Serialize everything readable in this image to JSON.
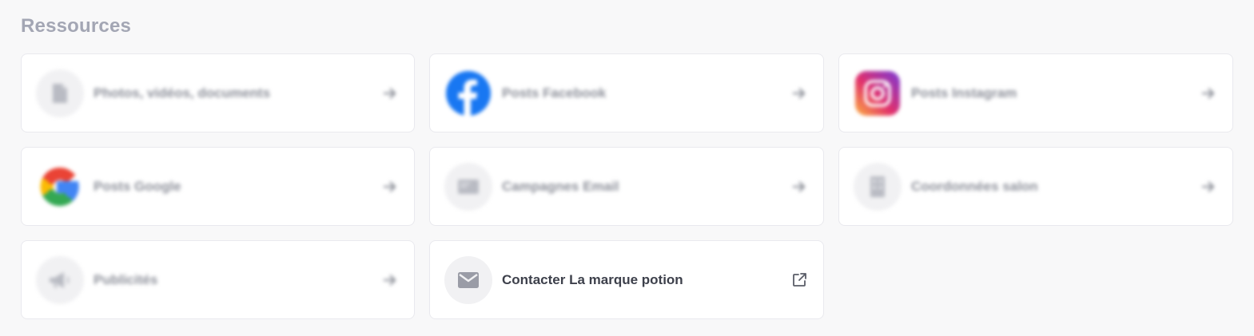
{
  "section": {
    "title": "Ressources"
  },
  "cards": [
    {
      "label": "Photos, vidéos, documents",
      "icon": "document-icon",
      "action": "arrow-right-icon"
    },
    {
      "label": "Posts Facebook",
      "icon": "facebook-icon",
      "action": "arrow-right-icon"
    },
    {
      "label": "Posts Instagram",
      "icon": "instagram-icon",
      "action": "arrow-right-icon"
    },
    {
      "label": "Posts Google",
      "icon": "google-icon",
      "action": "arrow-right-icon"
    },
    {
      "label": "Campagnes Email",
      "icon": "email-campaign-icon",
      "action": "arrow-right-icon"
    },
    {
      "label": "Coordonnées salon",
      "icon": "building-icon",
      "action": "arrow-right-icon"
    },
    {
      "label": "Publicités",
      "icon": "megaphone-icon",
      "action": "arrow-right-icon"
    },
    {
      "label": "Contacter La marque potion",
      "icon": "envelope-icon",
      "action": "external-link-icon"
    }
  ],
  "colors": {
    "background": "#f8f8f9",
    "card": "#ffffff",
    "title": "#a3a6b4",
    "facebook": "#1877f2",
    "icon_gray": "#9a9ca6"
  }
}
